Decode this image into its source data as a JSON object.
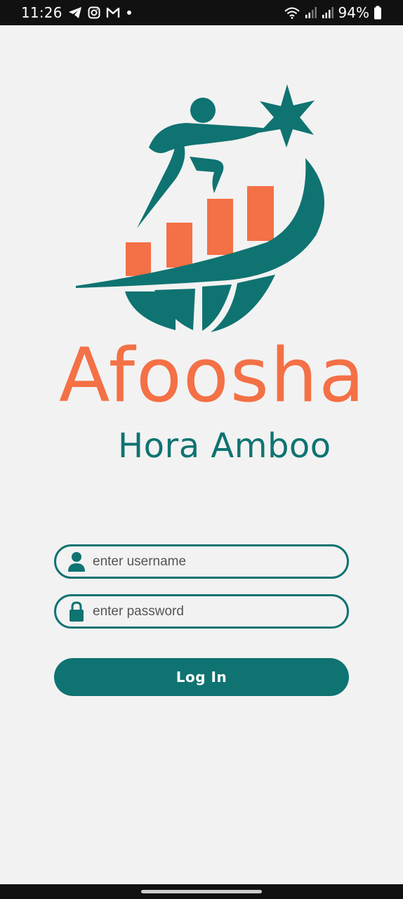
{
  "status_bar": {
    "time": "11:26",
    "battery": "94%",
    "icons_left": [
      "telegram-icon",
      "instagram-icon",
      "gmail-icon",
      "dot-icon"
    ],
    "icons_right": [
      "wifi-icon",
      "signal-icon",
      "signal-icon",
      "battery-icon"
    ]
  },
  "brand": {
    "title": "Afoosha",
    "subtitle": "Hora Amboo",
    "colors": {
      "teal": "#0f7371",
      "orange": "#f47046"
    }
  },
  "form": {
    "username_placeholder": "enter username",
    "username_value": "",
    "password_placeholder": "enter password",
    "password_value": "",
    "login_label": "Log In"
  }
}
